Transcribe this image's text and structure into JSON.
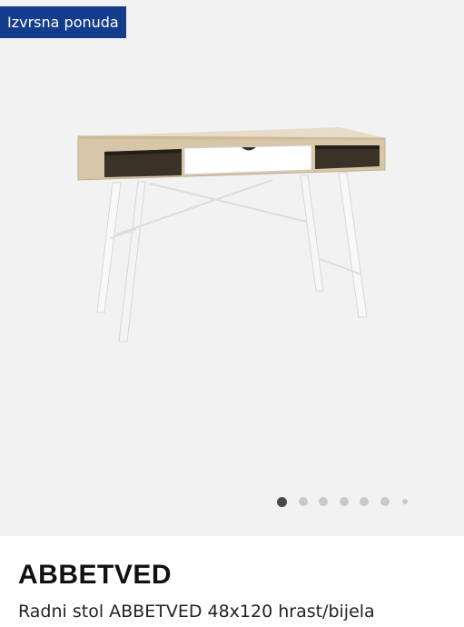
{
  "badge": {
    "label": "Izvrsna ponuda",
    "color": "#143c8c"
  },
  "gallery": {
    "image_subject": "desk",
    "image_count": 7,
    "active_index": 0
  },
  "product": {
    "name": "ABBETVED",
    "description": "Radni stol ABBETVED 48x120 hrast/bijela"
  }
}
